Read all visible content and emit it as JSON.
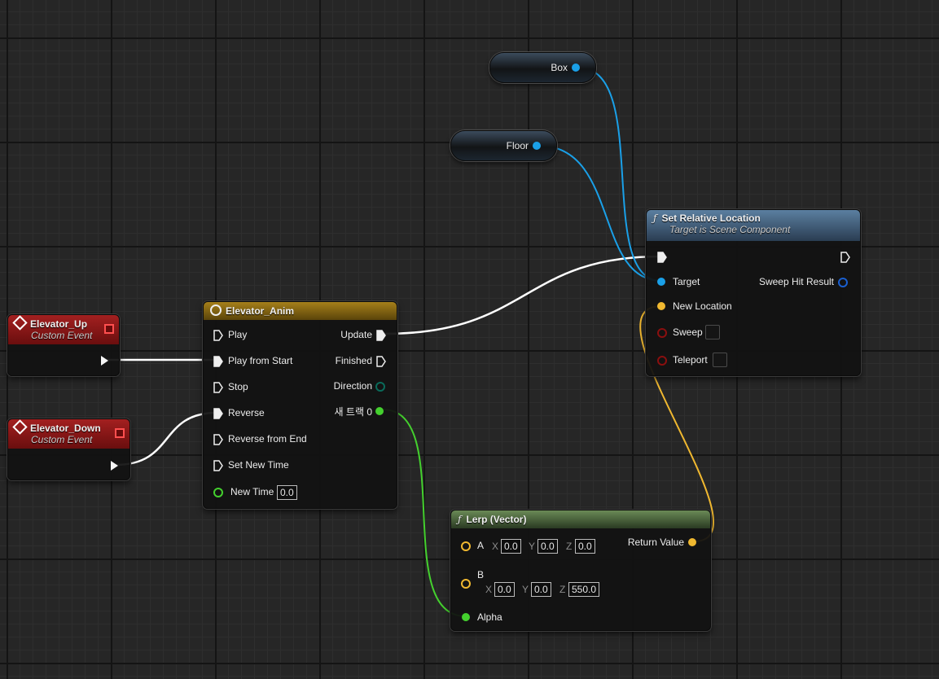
{
  "nodes": {
    "box_var": {
      "label": "Box"
    },
    "floor_var": {
      "label": "Floor"
    },
    "elevator_up": {
      "title": "Elevator_Up",
      "subtitle": "Custom Event"
    },
    "elevator_down": {
      "title": "Elevator_Down",
      "subtitle": "Custom Event"
    },
    "timeline": {
      "title": "Elevator_Anim",
      "inputs": [
        "Play",
        "Play from Start",
        "Stop",
        "Reverse",
        "Reverse from End",
        "Set New Time"
      ],
      "new_time_label": "New Time",
      "new_time_value": "0.0",
      "outputs": [
        "Update",
        "Finished",
        "Direction",
        "새 트랙 0"
      ]
    },
    "set_rel_loc": {
      "title": "Set Relative Location",
      "subtitle": "Target is Scene Component",
      "target_label": "Target",
      "sweep_hit_label": "Sweep Hit Result",
      "new_location_label": "New Location",
      "sweep_label": "Sweep",
      "teleport_label": "Teleport"
    },
    "lerp": {
      "title": "Lerp (Vector)",
      "a_label": "A",
      "b_label": "B",
      "alpha_label": "Alpha",
      "return_label": "Return Value",
      "axis_x": "X",
      "axis_y": "Y",
      "axis_z": "Z",
      "a_values": [
        "0.0",
        "0.0",
        "0.0"
      ],
      "b_values": [
        "0.0",
        "0.0",
        "550.0"
      ]
    }
  },
  "colors": {
    "event_header": "#8b1616",
    "timeline_header": "#8a6b12",
    "function_header": "#4f6f8f",
    "pure_function_header": "#4a6a3a",
    "exec_wire": "#ffffff",
    "object_pin": "#1aa0e8",
    "vector_pin": "#f0b830",
    "float_pin": "#44d02e",
    "bool_pin": "#8a0f0f",
    "struct_pin": "#1a5fd0",
    "enum_pin": "#0a6a5a"
  },
  "icons": {
    "event_icon": "diamond-event-icon",
    "timeline_icon": "clock-icon",
    "function_icon": "function-f-icon",
    "delegate_icon": "red-square-delegate-icon"
  }
}
